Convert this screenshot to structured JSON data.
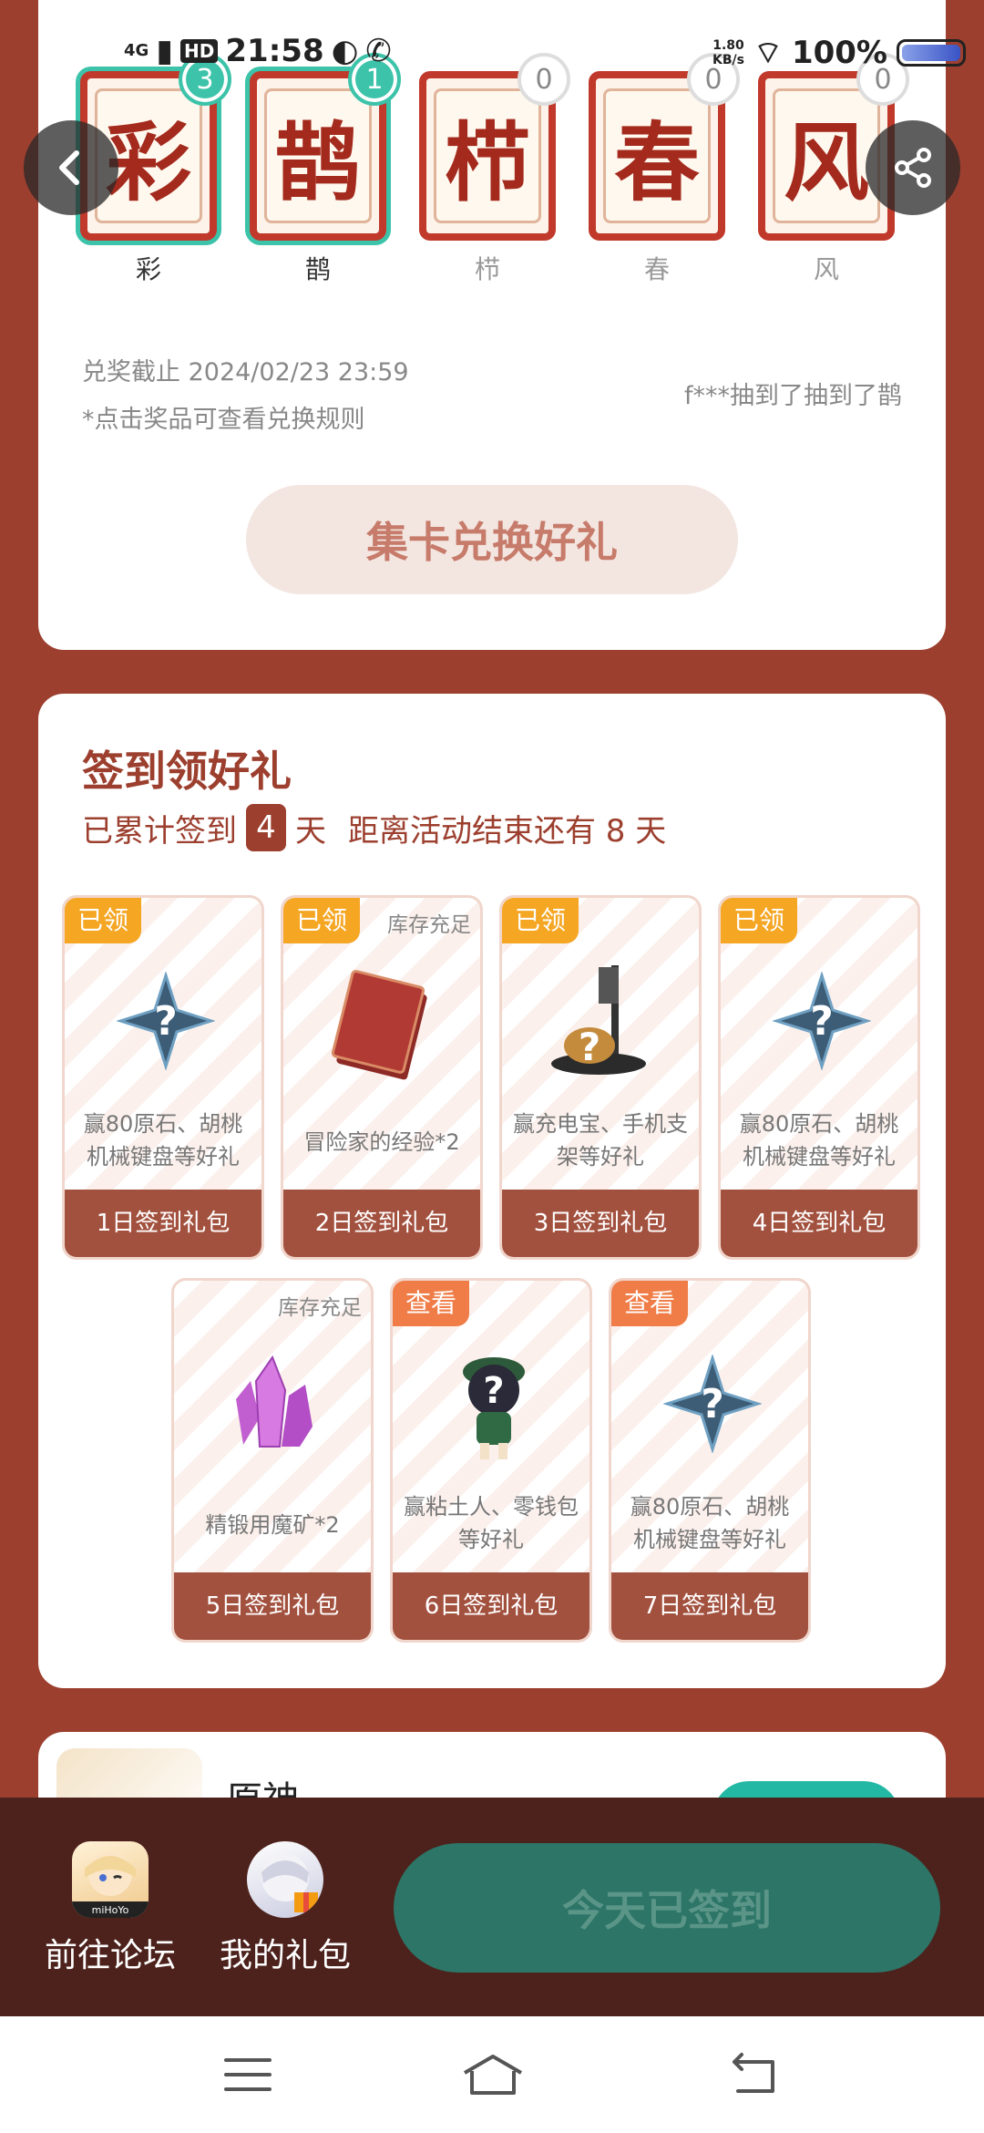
{
  "status_bar": {
    "network": "4G",
    "hd": "HD",
    "time": "21:58",
    "speed_value": "1.80",
    "speed_unit": "KB/s",
    "battery": "100%"
  },
  "cards": [
    {
      "char": "彩",
      "count": "3",
      "label": "彩",
      "collected": true
    },
    {
      "char": "鹊",
      "count": "1",
      "label": "鹊",
      "collected": true
    },
    {
      "char": "栉",
      "count": "0",
      "label": "栉",
      "collected": false
    },
    {
      "char": "春",
      "count": "0",
      "label": "春",
      "collected": false
    },
    {
      "char": "风",
      "count": "0",
      "label": "风",
      "collected": false
    }
  ],
  "notices": {
    "deadline": "兑奖截止 2024/02/23 23:59",
    "rule_hint": "*点击奖品可查看兑换规则",
    "winner": "f***抽到了抽到了鹊"
  },
  "exchange_button": "集卡兑换好礼",
  "checkin": {
    "title": "签到领好礼",
    "prefix": "已累计签到",
    "days": "4",
    "suffix": "天",
    "remaining": "距离活动结束还有 8 天",
    "gifts": [
      {
        "tag": "已领",
        "tag_type": "claimed",
        "stock": "",
        "desc": "赢80原石、胡桃机械键盘等好礼",
        "footer": "1日签到礼包",
        "icon": "primogem-mystery-icon"
      },
      {
        "tag": "已领",
        "tag_type": "claimed",
        "stock": "库存充足",
        "desc": "冒险家的经验*2",
        "footer": "2日签到礼包",
        "icon": "adventurer-exp-book-icon"
      },
      {
        "tag": "已领",
        "tag_type": "claimed",
        "stock": "",
        "desc": "赢充电宝、手机支架等好礼",
        "footer": "3日签到礼包",
        "icon": "phone-stand-mystery-icon"
      },
      {
        "tag": "已领",
        "tag_type": "claimed",
        "stock": "",
        "desc": "赢80原石、胡桃机械键盘等好礼",
        "footer": "4日签到礼包",
        "icon": "primogem-mystery-icon"
      },
      {
        "tag": "",
        "tag_type": "none",
        "stock": "库存充足",
        "desc": "精锻用魔矿*2",
        "footer": "5日签到礼包",
        "icon": "mystic-ore-icon"
      },
      {
        "tag": "查看",
        "tag_type": "view",
        "stock": "",
        "desc": "赢粘土人、零钱包等好礼",
        "footer": "6日签到礼包",
        "icon": "figure-mystery-icon"
      },
      {
        "tag": "查看",
        "tag_type": "view",
        "stock": "",
        "desc": "赢80原石、胡桃机械键盘等好礼",
        "footer": "7日签到礼包",
        "icon": "primogem-mystery-icon"
      }
    ]
  },
  "game": {
    "name": "原神"
  },
  "bottom_nav": {
    "forum": "前往论坛",
    "gifts": "我的礼包",
    "signed": "今天已签到",
    "forum_icon_text": "miHoYo"
  },
  "colors": {
    "accent": "#9c3f2e",
    "teal": "#3cc3a9",
    "claimed_tag": "#f5a623",
    "view_tag": "#f07d48"
  }
}
